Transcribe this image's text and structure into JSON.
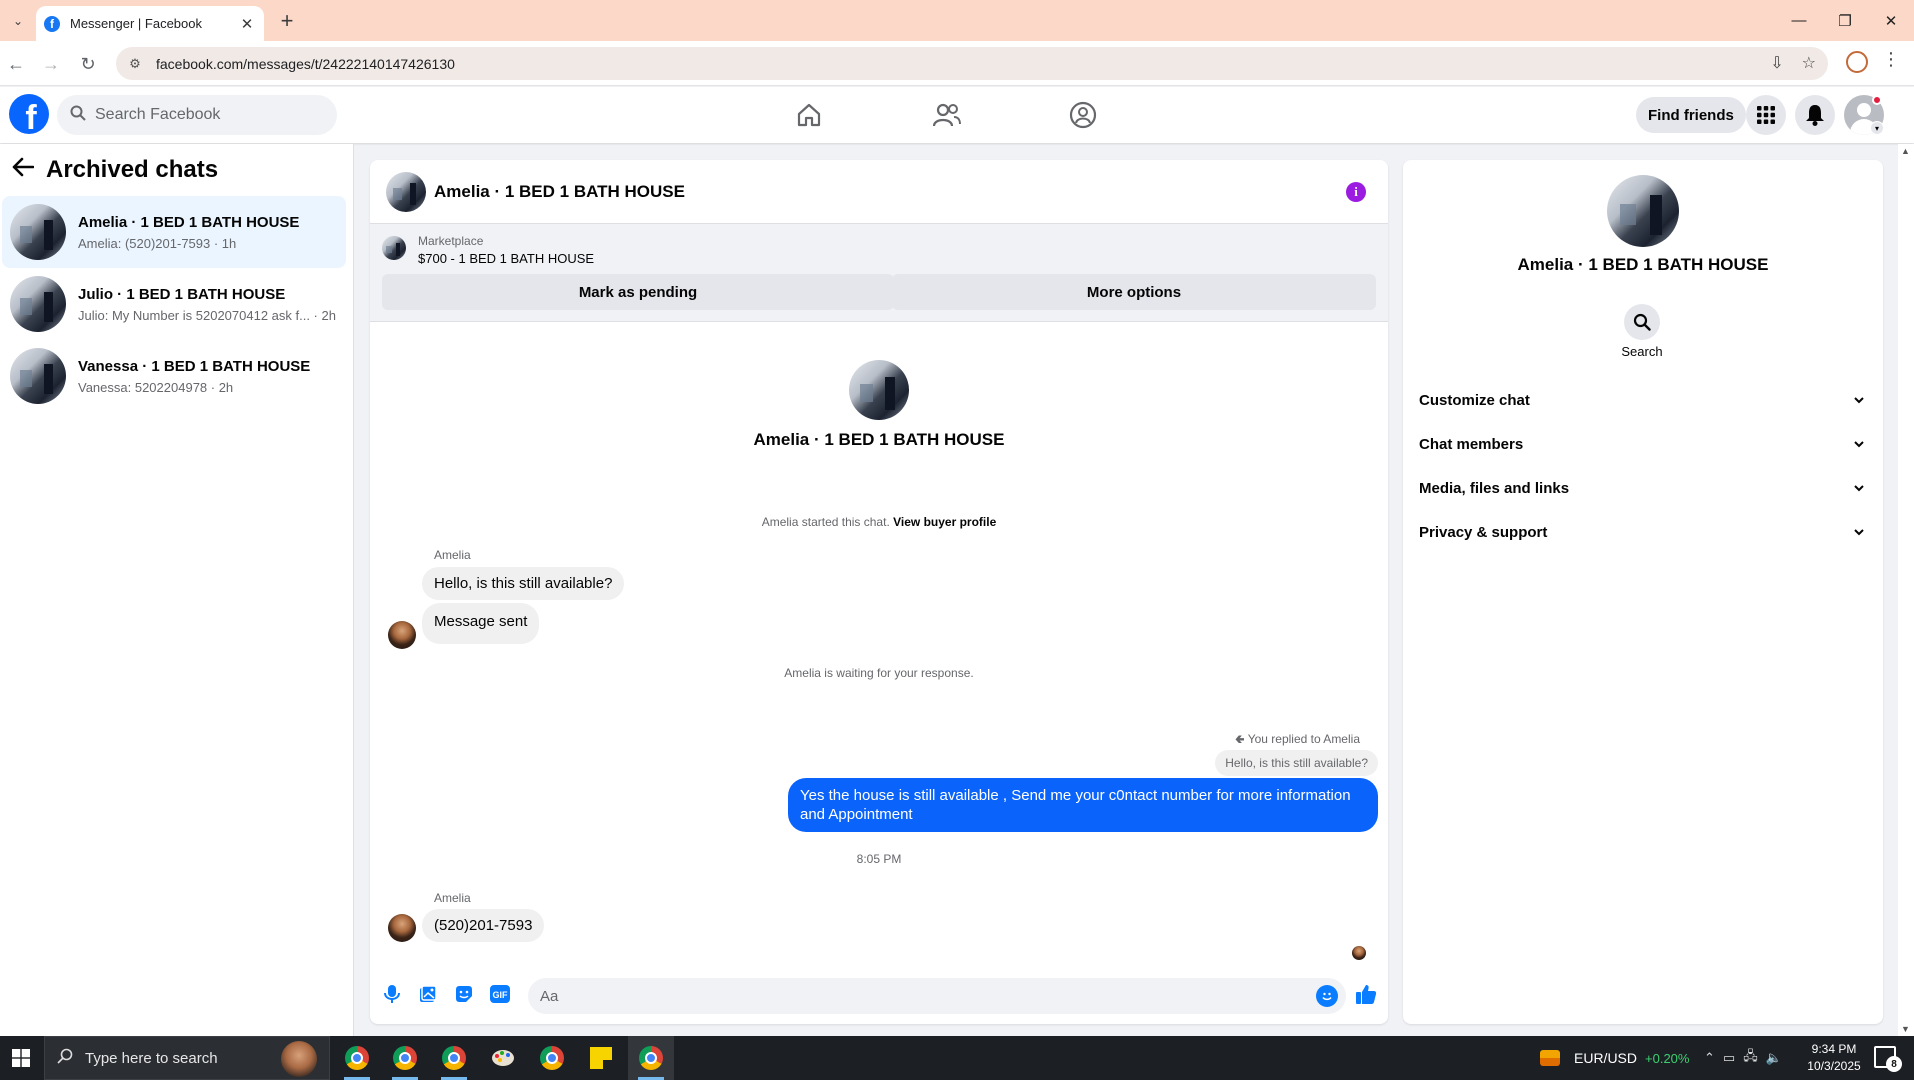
{
  "browser": {
    "tab_title": "Messenger | Facebook",
    "url": "facebook.com/messages/t/24222140147426130",
    "new_tab": "+",
    "close_tab": "✕"
  },
  "fb_nav": {
    "search_placeholder": "Search Facebook",
    "find_friends_label": "Find friends"
  },
  "sidebar": {
    "title": "Archived chats",
    "chats": [
      {
        "name": "Amelia · 1 BED 1 BATH HOUSE",
        "preview": "Amelia: (520)201-7593 · 1h",
        "active": true
      },
      {
        "name": "Julio · 1 BED 1 BATH HOUSE",
        "preview": "Julio: My Number is 5202070412 ask f... · 2h",
        "active": false
      },
      {
        "name": "Vanessa · 1 BED 1 BATH HOUSE",
        "preview": "Vanessa: 5202204978 · 2h",
        "active": false
      }
    ]
  },
  "conversation": {
    "title": "Amelia · 1 BED 1 BATH HOUSE",
    "marketplace_label": "Marketplace",
    "listing": "$700 - 1 BED 1 BATH HOUSE",
    "mark_pending_label": "Mark as pending",
    "more_options_label": "More options",
    "intro_name": "Amelia · 1 BED 1 BATH HOUSE",
    "started_text": "Amelia started this chat.",
    "view_buyer_label": "View buyer profile",
    "sender_1": "Amelia",
    "msg_1": "Hello, is this still available?",
    "msg_2": "Message sent",
    "waiting_text": "Amelia is waiting for your response.",
    "replied_label": "You replied to Amelia",
    "reply_quote": "Hello, is this still available?",
    "outgoing_msg": "Yes the house is still available , Send me your c0ntact number for more information and Appointment",
    "time": "8:05 PM",
    "sender_2": "Amelia",
    "msg_3": "(520)201-7593",
    "composer_placeholder": "Aa"
  },
  "details": {
    "name": "Amelia · 1 BED 1 BATH HOUSE",
    "search_label": "Search",
    "sections": [
      "Customize chat",
      "Chat members",
      "Media, files and links",
      "Privacy & support"
    ]
  },
  "taskbar": {
    "search_placeholder": "Type here to search",
    "ticker_symbol": "EUR/USD",
    "ticker_change": "+0.20%",
    "time": "9:34 PM",
    "date": "10/3/2025",
    "notif_count": "8"
  },
  "colors": {
    "fb_blue": "#0866ff",
    "outgoing_bubble": "#0a64fb",
    "info_purple": "#9b1be0",
    "active_chat": "#ebf5ff",
    "tabbar": "#fcd8c8"
  }
}
